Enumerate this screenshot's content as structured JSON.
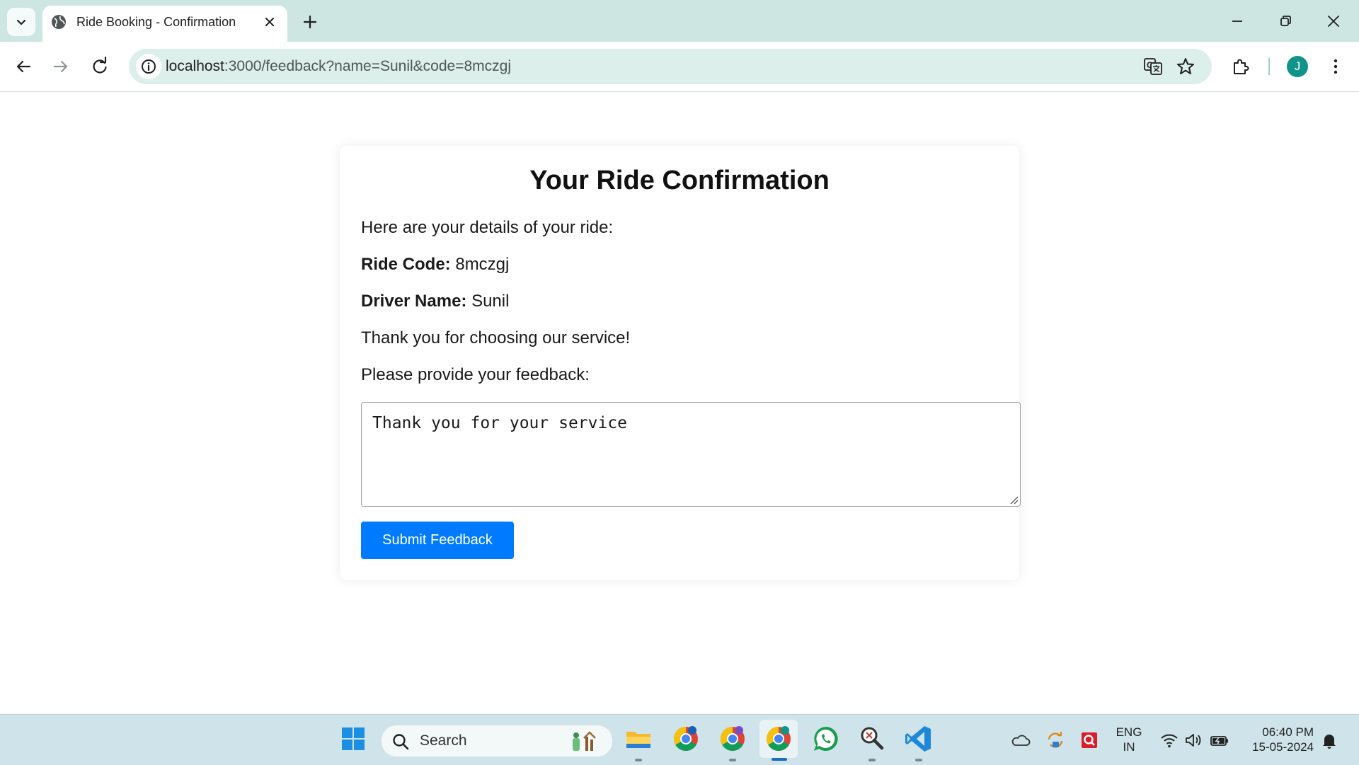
{
  "browser": {
    "tab_title": "Ride Booking - Confirmation",
    "url_host": "localhost",
    "url_path": ":3000/feedback?name=Sunil&code=8mczgj",
    "avatar_letter": "J",
    "accent": "#10948a"
  },
  "page": {
    "heading": "Your Ride Confirmation",
    "intro": "Here are your details of your ride:",
    "ride_code_label": "Ride Code:",
    "ride_code_value": "8mczgj",
    "driver_label": "Driver Name:",
    "driver_value": "Sunil",
    "thanks": "Thank you for choosing our service!",
    "feedback_prompt": "Please provide your feedback:",
    "feedback_value": "Thank you for your service",
    "submit_label": "Submit Feedback",
    "button_color": "#007bff"
  },
  "taskbar": {
    "search_label": "Search",
    "lang_line1": "ENG",
    "lang_line2": "IN",
    "time": "06:40 PM",
    "date": "15-05-2024",
    "apps": [
      "start-icon",
      "file-explorer-icon",
      "chrome-icon",
      "chrome-icon",
      "chrome-icon",
      "whatsapp-icon",
      "magnifier-icon",
      "vscode-icon"
    ]
  }
}
